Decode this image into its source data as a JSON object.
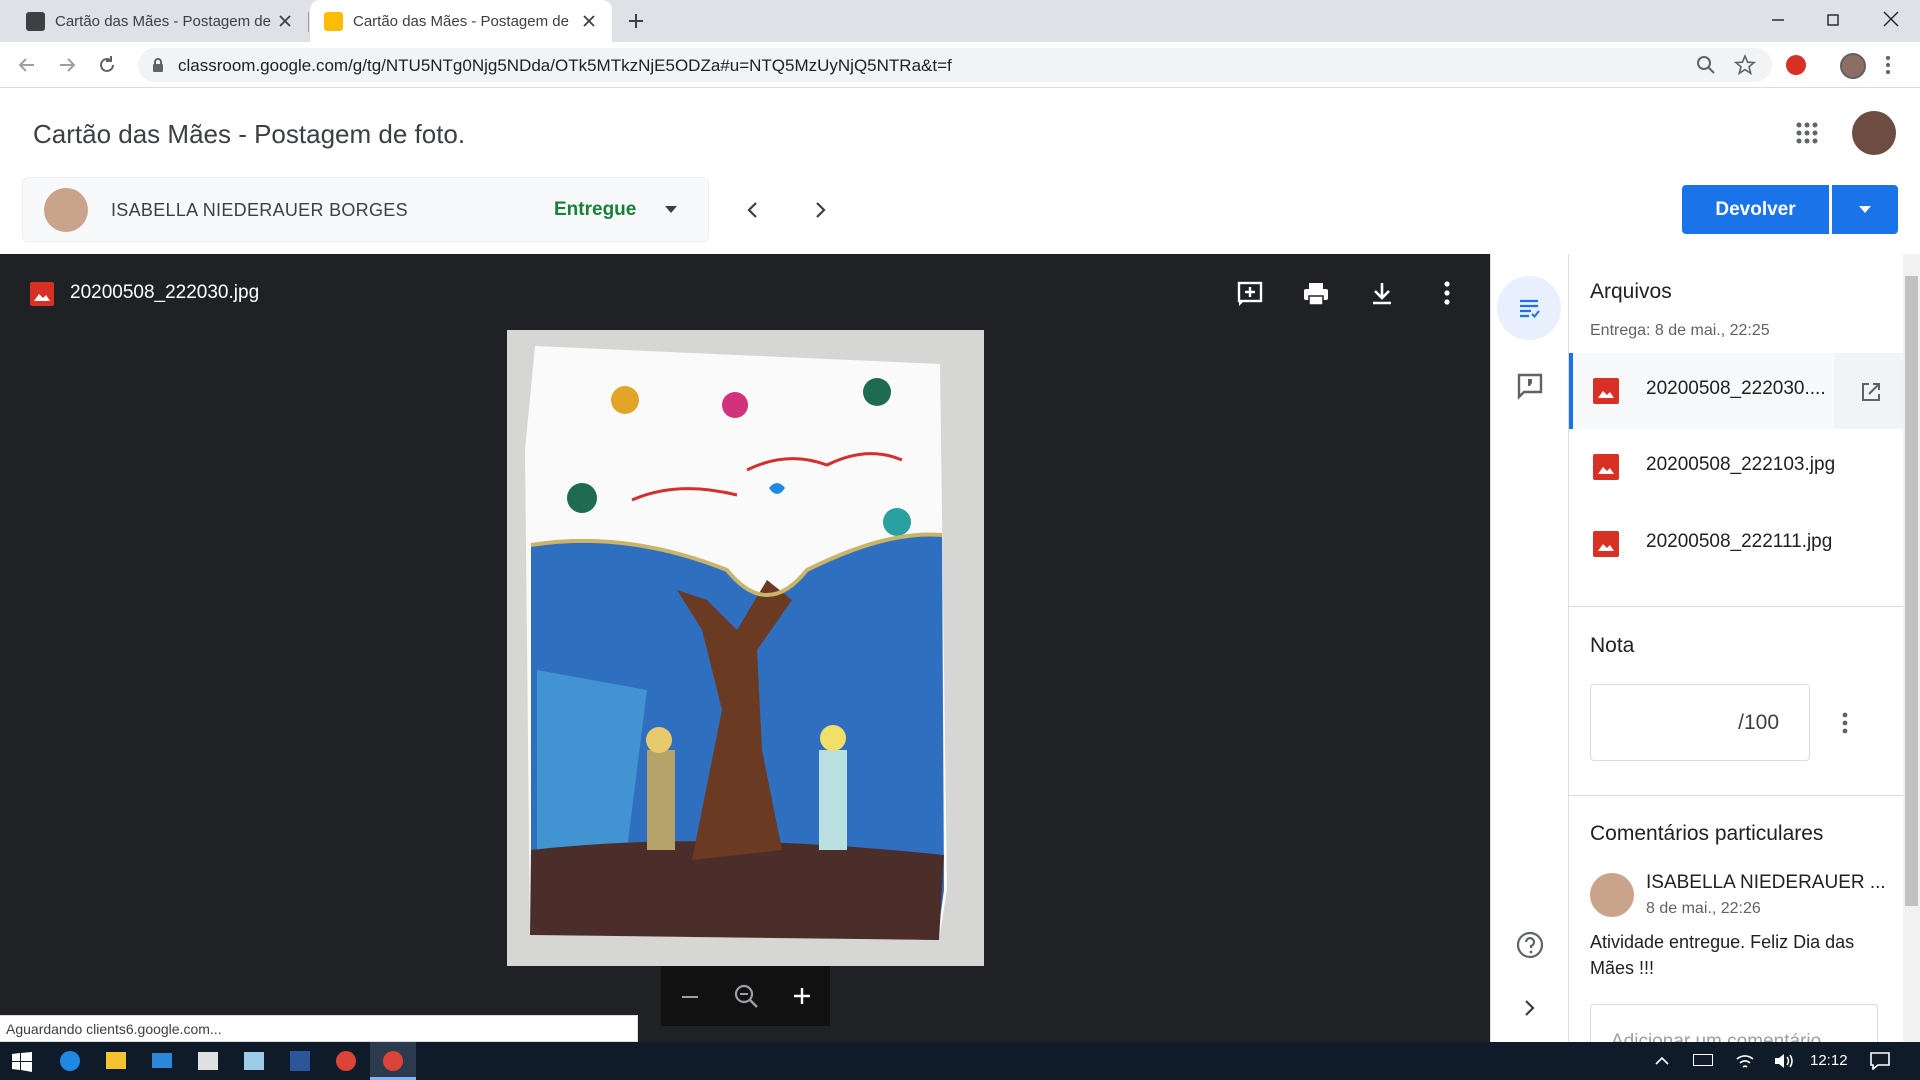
{
  "browser": {
    "tabs": [
      {
        "title": "Cartão das Mães - Postagem de foto."
      },
      {
        "title": "Cartão das Mães - Postagem de foto."
      }
    ],
    "url": "classroom.google.com/g/tg/NTU5NTg0Njg5NDda/OTk5MTkzNjE5ODZa#u=NTQ5MzUyNjQ5NTRa&t=f"
  },
  "header": {
    "title": "Cartão das Mães - Postagem de foto."
  },
  "student": {
    "name": "ISABELLA NIEDERAUER BORGES",
    "status": "Entregue"
  },
  "actions": {
    "return_label": "Devolver"
  },
  "viewer": {
    "file_name": "20200508_222030.jpg",
    "image_description_icon": "image-icon"
  },
  "sidebar": {
    "files_heading": "Arquivos",
    "submitted": "Entrega: 8 de mai., 22:25",
    "files": [
      {
        "name": "20200508_222030...."
      },
      {
        "name": "20200508_222103.jpg"
      },
      {
        "name": "20200508_222111.jpg"
      }
    ],
    "grade_heading": "Nota",
    "grade_denominator": "/100",
    "comments_heading": "Comentários particulares",
    "comment": {
      "author": "ISABELLA NIEDERAUER ...",
      "time": "8 de mai., 22:26",
      "text": "Atividade entregue. Feliz Dia das Mães !!!"
    },
    "comment_placeholder": "Adicionar um comentário"
  },
  "status_bar": "Aguardando clients6.google.com...",
  "taskbar": {
    "clock": "12:12"
  },
  "colors": {
    "accent": "#1a73e8",
    "status_green": "#188038",
    "viewer_bg": "#202124",
    "file_icon_red": "#d93025"
  }
}
